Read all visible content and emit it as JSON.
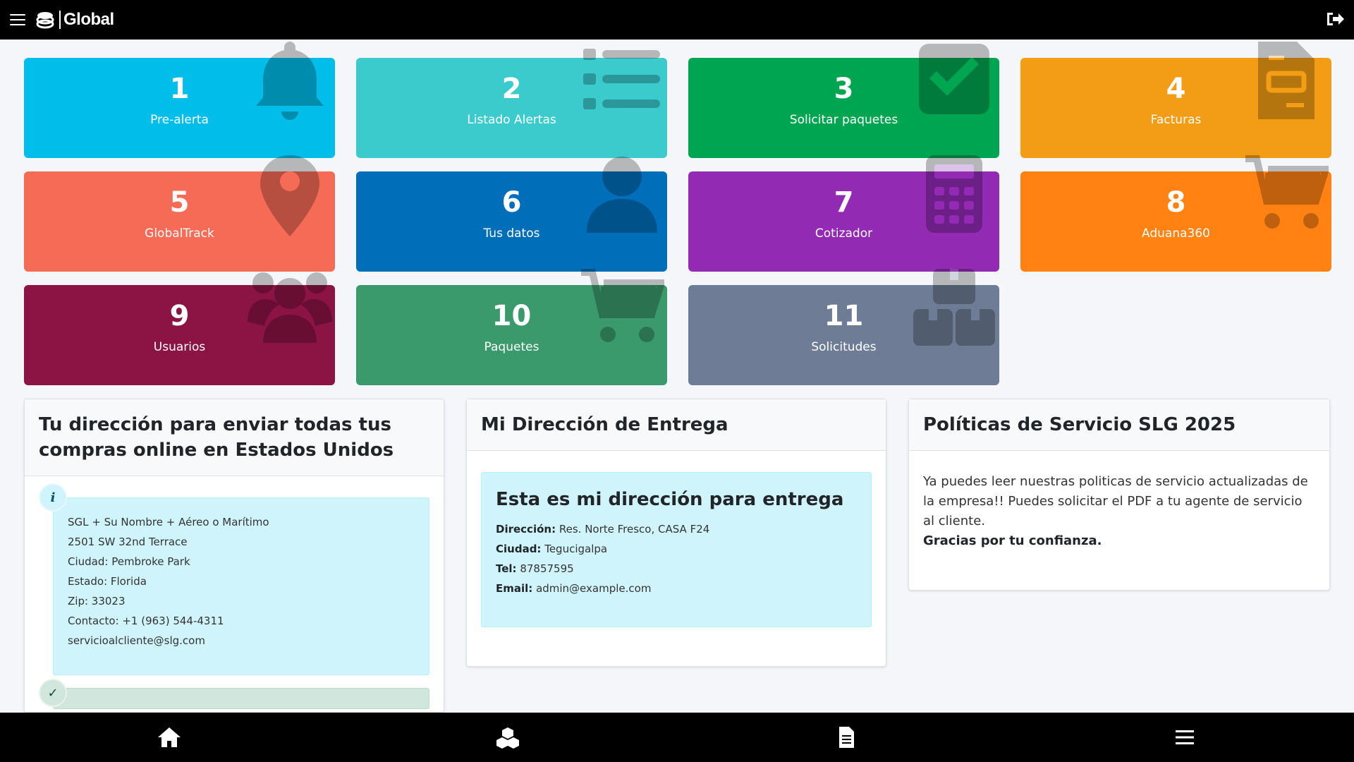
{
  "header": {
    "brand": "Global"
  },
  "tiles": [
    {
      "num": "1",
      "label": "Pre-alerta",
      "color": "#00bde9",
      "icon": "bell-icon"
    },
    {
      "num": "2",
      "label": "Listado Alertas",
      "color": "#3ccbcd",
      "icon": "list-icon"
    },
    {
      "num": "3",
      "label": "Solicitar paquetes",
      "color": "#00a551",
      "icon": "check-square-icon"
    },
    {
      "num": "4",
      "label": "Facturas",
      "color": "#f29d15",
      "icon": "invoice-icon"
    },
    {
      "num": "5",
      "label": "GlobalTrack",
      "color": "#f56b56",
      "icon": "map-pin-icon"
    },
    {
      "num": "6",
      "label": "Tus datos",
      "color": "#006eb9",
      "icon": "user-icon"
    },
    {
      "num": "7",
      "label": "Cotizador",
      "color": "#922ab4",
      "icon": "calculator-icon"
    },
    {
      "num": "8",
      "label": "Aduana360",
      "color": "#ff8213",
      "icon": "cart-icon"
    },
    {
      "num": "9",
      "label": "Usuarios",
      "color": "#8c1444",
      "icon": "users-icon"
    },
    {
      "num": "10",
      "label": "Paquetes",
      "color": "#3a9a6c",
      "icon": "cart-icon"
    },
    {
      "num": "11",
      "label": "Solicitudes",
      "color": "#6e7c96",
      "icon": "boxes-icon"
    }
  ],
  "us_address": {
    "title": "Tu dirección para enviar todas tus compras online en Estados Unidos",
    "lines": [
      "SGL + Su Nombre + Aéreo o Marítimo",
      "2501 SW 32nd Terrace",
      "Ciudad: Pembroke Park",
      "Estado: Florida",
      "Zip: 33023",
      "Contacto: +1 (963) 544-4311",
      "servicioalcliente@slg.com"
    ]
  },
  "delivery": {
    "title": "Mi Dirección de Entrega",
    "box_title": "Esta es mi dirección para entrega",
    "address_label": "Dirección:",
    "address_value": "Res. Norte Fresco, CASA F24",
    "city_label": "Ciudad:",
    "city_value": "Tegucigalpa",
    "phone_label": "Tel:",
    "phone_value": "87857595",
    "email_label": "Email:",
    "email_value": "admin@example.com"
  },
  "policy": {
    "title": "Políticas de Servicio SLG 2025",
    "text": "Ya puedes leer nuestras politicas de servicio actualizadas de la empresa!! Puedes solicitar el PDF a tu agente de servicio al cliente.",
    "thanks": "Gracias por tu confianza."
  },
  "bottom_nav": [
    "home-icon",
    "boxes-icon",
    "document-icon",
    "menu-icon"
  ]
}
